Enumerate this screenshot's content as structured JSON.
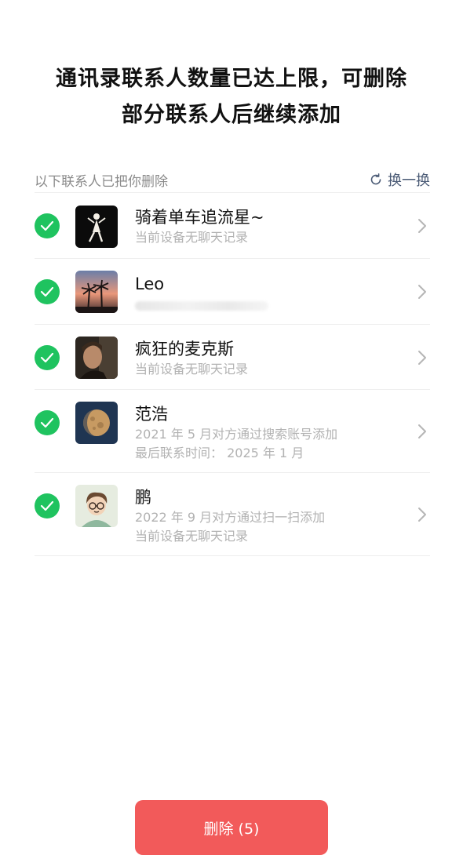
{
  "header": {
    "title_line1": "通讯录联系人数量已达上限，可删除",
    "title_line2": "部分联系人后继续添加"
  },
  "section": {
    "label": "以下联系人已把你删除",
    "refresh_label": "换一换"
  },
  "contacts": [
    {
      "name": "骑着单车追流星~",
      "line1": "当前设备无聊天记录",
      "line2": "",
      "checked": true,
      "avatar_icon": "sailor-moon-silhouette"
    },
    {
      "name": "Leo",
      "line1": "",
      "line2": "",
      "blurred": true,
      "checked": true,
      "avatar_icon": "palm-tree-sunset"
    },
    {
      "name": "疯狂的麦克斯",
      "line1": "当前设备无聊天记录",
      "line2": "",
      "checked": true,
      "avatar_icon": "man-portrait"
    },
    {
      "name": "范浩",
      "line1": "2021 年 5 月对方通过搜索账号添加",
      "line2": "最后联系时间： 2025 年 1 月",
      "checked": true,
      "avatar_icon": "moon"
    },
    {
      "name": "鹏",
      "line1": "2022 年 9 月对方通过扫一扫添加",
      "line2": "当前设备无聊天记录",
      "checked": true,
      "avatar_icon": "cartoon-boy"
    }
  ],
  "footer": {
    "delete_label": "删除 (5)"
  },
  "colors": {
    "check_green": "#1fc35f",
    "delete_red": "#f25a5a",
    "link_blue": "#4a5a75"
  }
}
